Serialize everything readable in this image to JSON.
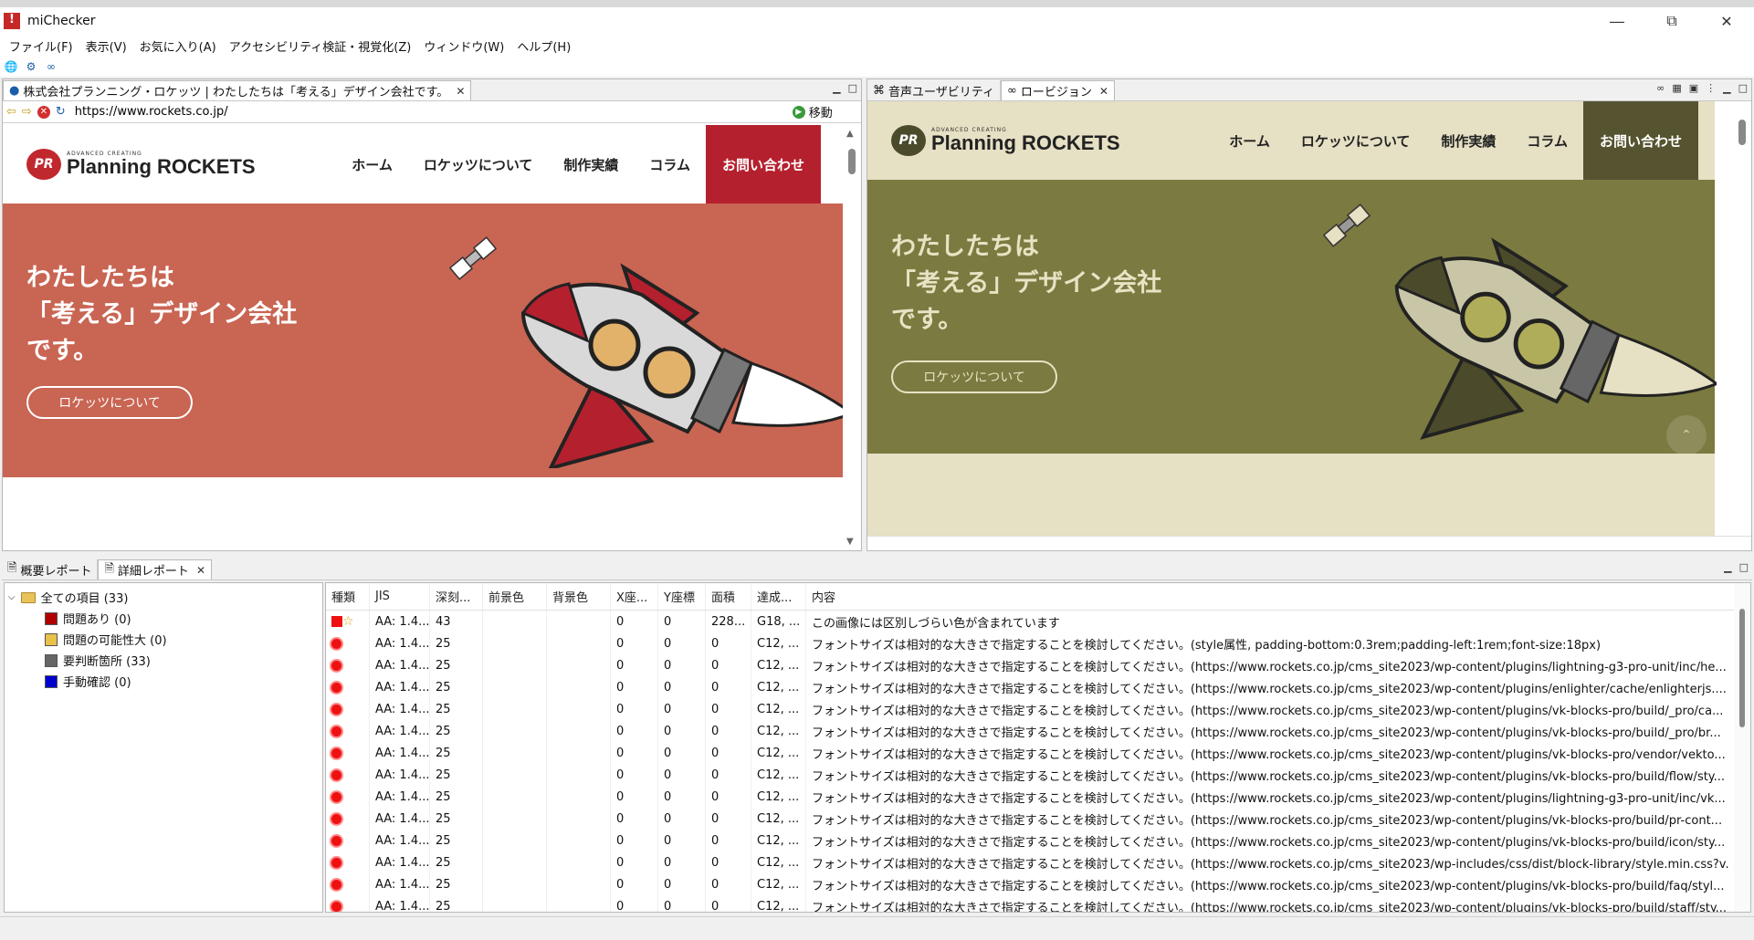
{
  "window": {
    "title": "miChecker"
  },
  "menu": [
    "ファイル(F)",
    "表示(V)",
    "お気に入り(A)",
    "アクセシビリティ検証・視覚化(Z)",
    "ウィンドウ(W)",
    "ヘルプ(H)"
  ],
  "browser": {
    "tab_title": "株式会社プランニング・ロケッツ | わたしたちは「考える」デザイン会社です。",
    "url": "https://www.rockets.co.jp/",
    "go_label": "移動"
  },
  "site": {
    "logo_small": "ADVANCED CREATING",
    "logo_big": "Planning ROCKETS",
    "logo_mark": "PR",
    "nav": [
      "ホーム",
      "ロケッツについて",
      "制作実績",
      "コラム"
    ],
    "nav_cta": "お問い合わせ",
    "hero_line1": "わたしたちは",
    "hero_line2": "「考える」デザイン会社",
    "hero_line3": "です。",
    "hero_button": "ロケッツについて"
  },
  "simulation": {
    "tab_voice": "音声ユーザビリティ",
    "tab_lowvision": "ロービジョン"
  },
  "report": {
    "tab_summary": "概要レポート",
    "tab_detail": "詳細レポート",
    "tree": {
      "root": "全ての項目 (33)",
      "items": [
        "問題あり (0)",
        "問題の可能性大 (0)",
        "要判断箇所 (33)",
        "手動確認 (0)"
      ],
      "colors": [
        "#b00000",
        "#e8c04a",
        "#666666",
        "#0000cc"
      ]
    },
    "columns": [
      "種類",
      "JIS",
      "深刻...",
      "前景色",
      "背景色",
      "X座...",
      "Y座標",
      "面積",
      "達成...",
      "内容"
    ],
    "rows": [
      {
        "jis": "AA: 1.4...",
        "sev": "43",
        "x": "0",
        "y": "0",
        "area": "228...",
        "crit": "G18, ...",
        "content": "この画像には区別しづらい色が含まれています"
      },
      {
        "jis": "AA: 1.4...",
        "sev": "25",
        "x": "0",
        "y": "0",
        "area": "0",
        "crit": "C12, ...",
        "content": "フォントサイズは相対的な大きさで指定することを検討してください。(style属性, padding-bottom:0.3rem;padding-left:1rem;font-size:18px)"
      },
      {
        "jis": "AA: 1.4...",
        "sev": "25",
        "x": "0",
        "y": "0",
        "area": "0",
        "crit": "C12, ...",
        "content": "フォントサイズは相対的な大きさで指定することを検討してください。(https://www.rockets.co.jp/cms_site2023/wp-content/plugins/lightning-g3-pro-unit/inc/he..."
      },
      {
        "jis": "AA: 1.4...",
        "sev": "25",
        "x": "0",
        "y": "0",
        "area": "0",
        "crit": "C12, ...",
        "content": "フォントサイズは相対的な大きさで指定することを検討してください。(https://www.rockets.co.jp/cms_site2023/wp-content/plugins/enlighter/cache/enlighterjs...."
      },
      {
        "jis": "AA: 1.4...",
        "sev": "25",
        "x": "0",
        "y": "0",
        "area": "0",
        "crit": "C12, ...",
        "content": "フォントサイズは相対的な大きさで指定することを検討してください。(https://www.rockets.co.jp/cms_site2023/wp-content/plugins/vk-blocks-pro/build/_pro/ca..."
      },
      {
        "jis": "AA: 1.4...",
        "sev": "25",
        "x": "0",
        "y": "0",
        "area": "0",
        "crit": "C12, ...",
        "content": "フォントサイズは相対的な大きさで指定することを検討してください。(https://www.rockets.co.jp/cms_site2023/wp-content/plugins/vk-blocks-pro/build/_pro/br..."
      },
      {
        "jis": "AA: 1.4...",
        "sev": "25",
        "x": "0",
        "y": "0",
        "area": "0",
        "crit": "C12, ...",
        "content": "フォントサイズは相対的な大きさで指定することを検討してください。(https://www.rockets.co.jp/cms_site2023/wp-content/plugins/vk-blocks-pro/vendor/vekto..."
      },
      {
        "jis": "AA: 1.4...",
        "sev": "25",
        "x": "0",
        "y": "0",
        "area": "0",
        "crit": "C12, ...",
        "content": "フォントサイズは相対的な大きさで指定することを検討してください。(https://www.rockets.co.jp/cms_site2023/wp-content/plugins/vk-blocks-pro/build/flow/sty..."
      },
      {
        "jis": "AA: 1.4...",
        "sev": "25",
        "x": "0",
        "y": "0",
        "area": "0",
        "crit": "C12, ...",
        "content": "フォントサイズは相対的な大きさで指定することを検討してください。(https://www.rockets.co.jp/cms_site2023/wp-content/plugins/lightning-g3-pro-unit/inc/vk..."
      },
      {
        "jis": "AA: 1.4...",
        "sev": "25",
        "x": "0",
        "y": "0",
        "area": "0",
        "crit": "C12, ...",
        "content": "フォントサイズは相対的な大きさで指定することを検討してください。(https://www.rockets.co.jp/cms_site2023/wp-content/plugins/vk-blocks-pro/build/pr-cont..."
      },
      {
        "jis": "AA: 1.4...",
        "sev": "25",
        "x": "0",
        "y": "0",
        "area": "0",
        "crit": "C12, ...",
        "content": "フォントサイズは相対的な大きさで指定することを検討してください。(https://www.rockets.co.jp/cms_site2023/wp-content/plugins/vk-blocks-pro/build/icon/sty..."
      },
      {
        "jis": "AA: 1.4...",
        "sev": "25",
        "x": "0",
        "y": "0",
        "area": "0",
        "crit": "C12, ...",
        "content": "フォントサイズは相対的な大きさで指定することを検討してください。(https://www.rockets.co.jp/cms_site2023/wp-includes/css/dist/block-library/style.min.css?v..."
      },
      {
        "jis": "AA: 1.4...",
        "sev": "25",
        "x": "0",
        "y": "0",
        "area": "0",
        "crit": "C12, ...",
        "content": "フォントサイズは相対的な大きさで指定することを検討してください。(https://www.rockets.co.jp/cms_site2023/wp-content/plugins/vk-blocks-pro/build/faq/styl..."
      },
      {
        "jis": "AA: 1.4...",
        "sev": "25",
        "x": "0",
        "y": "0",
        "area": "0",
        "crit": "C12, ...",
        "content": "フォントサイズは相対的な大きさで指定することを検討してください。(https://www.rockets.co.jp/cms_site2023/wp-content/plugins/vk-blocks-pro/build/staff/sty..."
      }
    ]
  },
  "colors": {
    "brand_red": "#b5202e",
    "hero_orange": "#c96553",
    "lowvision_olive": "#7b7a40"
  }
}
